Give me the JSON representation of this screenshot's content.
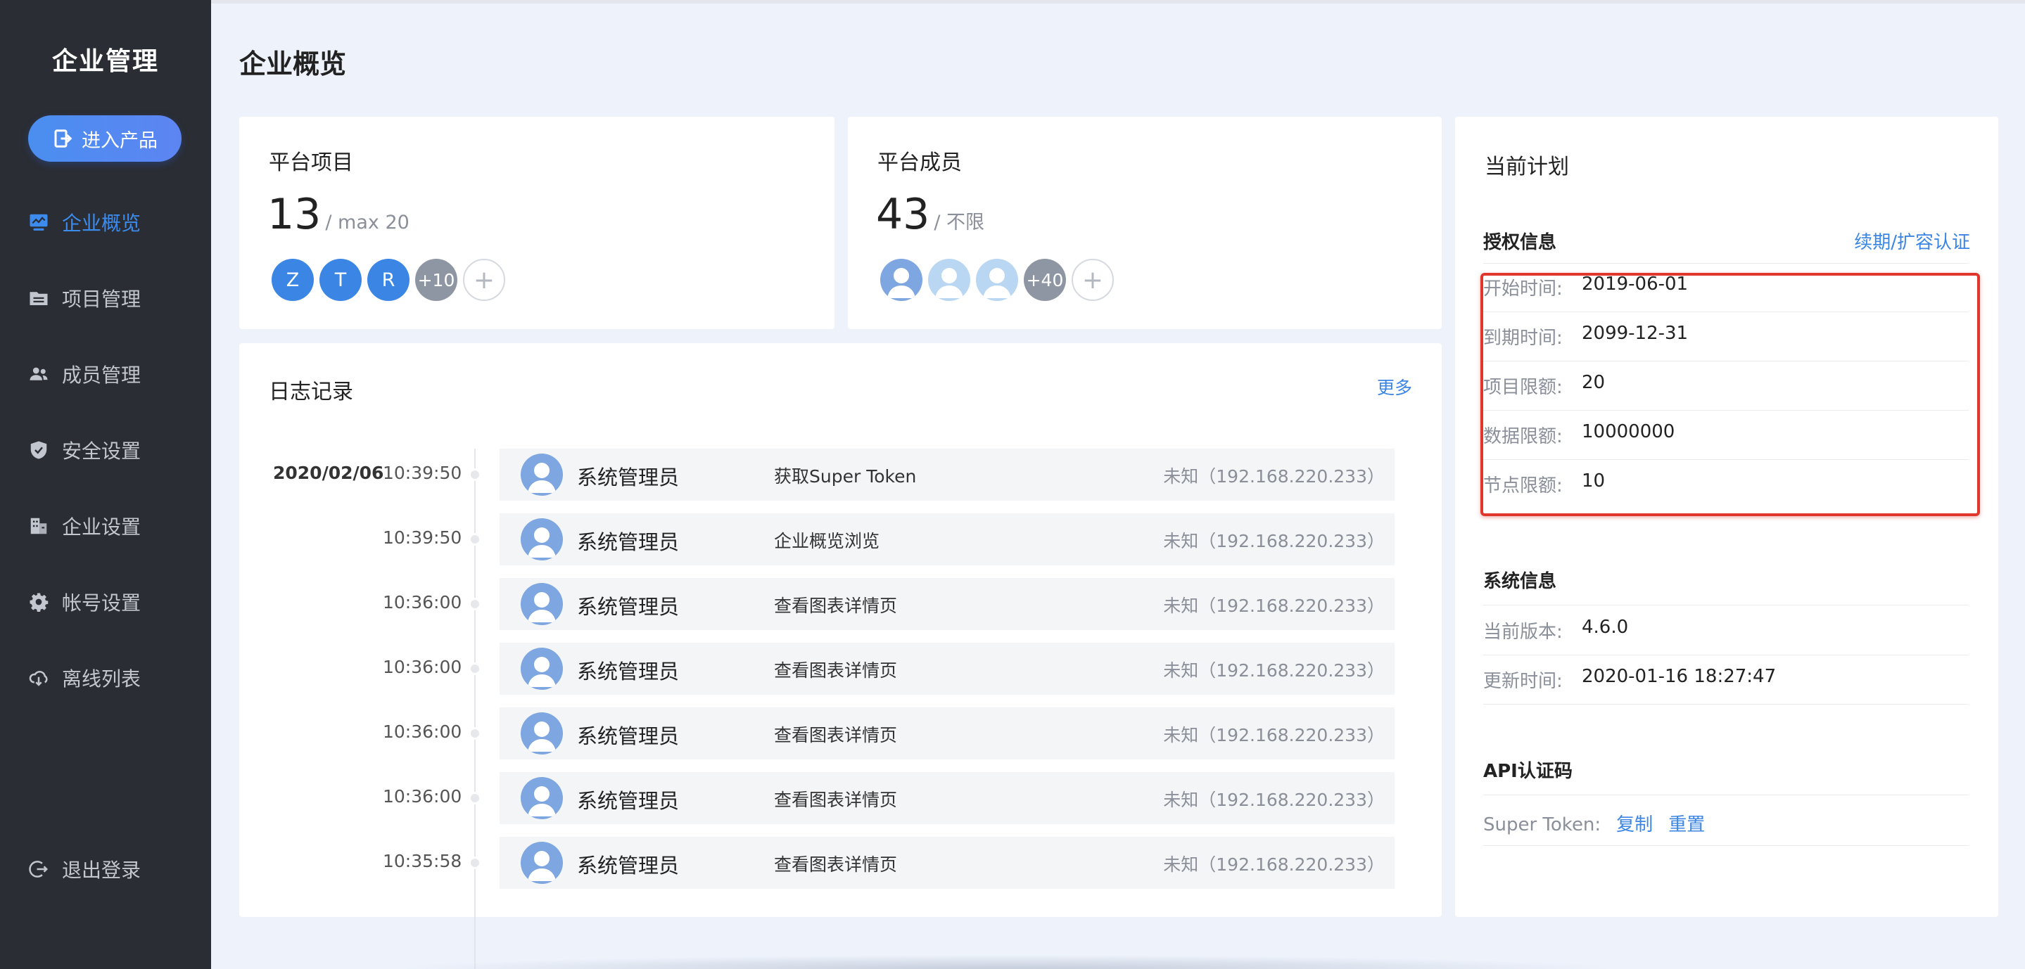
{
  "sidebar": {
    "brand": "企业管理",
    "enter_button": "进入产品",
    "items": [
      {
        "label": "企业概览",
        "icon": "monitor-icon",
        "active": true
      },
      {
        "label": "项目管理",
        "icon": "folder-icon",
        "active": false
      },
      {
        "label": "成员管理",
        "icon": "users-icon",
        "active": false
      },
      {
        "label": "安全设置",
        "icon": "shield-icon",
        "active": false
      },
      {
        "label": "企业设置",
        "icon": "building-icon",
        "active": false
      },
      {
        "label": "帐号设置",
        "icon": "gear-icon",
        "active": false
      },
      {
        "label": "离线列表",
        "icon": "cloud-icon",
        "active": false
      }
    ],
    "logout": "退出登录"
  },
  "page": {
    "title": "企业概览"
  },
  "projects": {
    "title": "平台项目",
    "count": "13",
    "limit": "/ max 20",
    "avatars": [
      "Z",
      "T",
      "R"
    ],
    "extra": "+10",
    "add": "+"
  },
  "members": {
    "title": "平台成员",
    "count": "43",
    "limit": "/ 不限",
    "extra": "+40",
    "add": "+"
  },
  "log": {
    "title": "日志记录",
    "more": "更多",
    "date": "2020/02/06",
    "rows": [
      {
        "time": "10:39:50",
        "user": "系统管理员",
        "action": "获取Super Token",
        "ip": "未知（192.168.220.233）"
      },
      {
        "time": "10:39:50",
        "user": "系统管理员",
        "action": "企业概览浏览",
        "ip": "未知（192.168.220.233）"
      },
      {
        "time": "10:36:00",
        "user": "系统管理员",
        "action": "查看图表详情页",
        "ip": "未知（192.168.220.233）"
      },
      {
        "time": "10:36:00",
        "user": "系统管理员",
        "action": "查看图表详情页",
        "ip": "未知（192.168.220.233）"
      },
      {
        "time": "10:36:00",
        "user": "系统管理员",
        "action": "查看图表详情页",
        "ip": "未知（192.168.220.233）"
      },
      {
        "time": "10:36:00",
        "user": "系统管理员",
        "action": "查看图表详情页",
        "ip": "未知（192.168.220.233）"
      },
      {
        "time": "10:35:58",
        "user": "系统管理员",
        "action": "查看图表详情页",
        "ip": "未知（192.168.220.233）"
      }
    ]
  },
  "plan": {
    "title": "当前计划",
    "license": {
      "title": "授权信息",
      "renew_link": "续期/扩容认证",
      "rows": [
        {
          "key": "开始时间:",
          "value": "2019-06-01"
        },
        {
          "key": "到期时间:",
          "value": "2099-12-31"
        },
        {
          "key": "项目限额:",
          "value": "20"
        },
        {
          "key": "数据限额:",
          "value": "10000000"
        },
        {
          "key": "节点限额:",
          "value": "10"
        }
      ]
    },
    "system": {
      "title": "系统信息",
      "rows": [
        {
          "key": "当前版本:",
          "value": "4.6.0"
        },
        {
          "key": "更新时间:",
          "value": "2020-01-16 18:27:47"
        }
      ]
    },
    "api": {
      "title": "API认证码",
      "token_label": "Super Token:",
      "copy": "复制",
      "reset": "重置"
    }
  },
  "colors": {
    "sidebar_bg": "#2a2d33",
    "accent": "#3b86e4",
    "page_bg": "#edf2fb",
    "highlight": "#e0362c"
  }
}
